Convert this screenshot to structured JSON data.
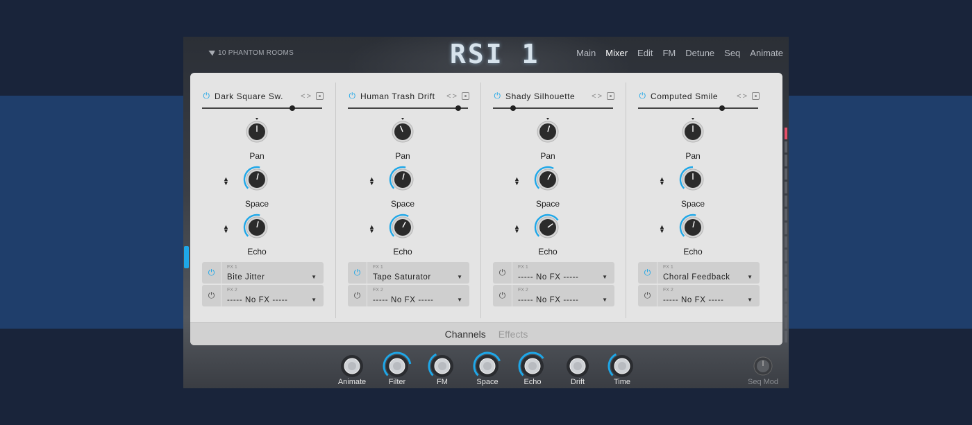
{
  "header": {
    "brand": "10 PHANTOM ROOMS",
    "logo": "RSI 1",
    "nav": [
      "Main",
      "Mixer",
      "Edit",
      "FM",
      "Detune",
      "Seq",
      "Animate"
    ],
    "active_nav": "Mixer"
  },
  "channels": [
    {
      "name": "Dark Square Sw.",
      "power": true,
      "level": 0.75,
      "pan": 0.5,
      "space": 0.55,
      "echo": 0.55,
      "fx1_label": "FX 1",
      "fx1": "Bite Jitter",
      "fx1_on": true,
      "fx2_label": "FX 2",
      "fx2": "----- No FX -----",
      "fx2_on": false
    },
    {
      "name": "Human Trash Drift",
      "power": true,
      "level": 0.92,
      "pan": 0.42,
      "space": 0.55,
      "echo": 0.6,
      "fx1_label": "FX 1",
      "fx1": "Tape Saturator",
      "fx1_on": true,
      "fx2_label": "FX 2",
      "fx2": "----- No FX -----",
      "fx2_on": false
    },
    {
      "name": "Shady Silhouette",
      "power": true,
      "level": 0.17,
      "pan": 0.56,
      "space": 0.6,
      "echo": 0.7,
      "fx1_label": "FX 1",
      "fx1": "----- No FX -----",
      "fx1_on": false,
      "fx2_label": "FX 2",
      "fx2": "----- No FX -----",
      "fx2_on": false
    },
    {
      "name": "Computed Smile",
      "power": true,
      "level": 0.7,
      "pan": 0.5,
      "space": 0.5,
      "echo": 0.55,
      "fx1_label": "FX 1",
      "fx1": "Choral Feedback",
      "fx1_on": true,
      "fx2_label": "FX 2",
      "fx2": "----- No FX -----",
      "fx2_on": false
    }
  ],
  "knob_labels": {
    "pan": "Pan",
    "space": "Space",
    "echo": "Echo"
  },
  "tabs": {
    "channels": "Channels",
    "effects": "Effects",
    "active": "Channels"
  },
  "macros": [
    {
      "label": "Animate",
      "value": 0.0
    },
    {
      "label": "Filter",
      "value": 0.8
    },
    {
      "label": "FM",
      "value": 0.4
    },
    {
      "label": "Space",
      "value": 0.75
    },
    {
      "label": "Echo",
      "value": 0.7
    },
    {
      "label": "Drift",
      "value": 0.0
    },
    {
      "label": "Time",
      "value": 0.4
    }
  ],
  "seq_mod": {
    "label": "Seq Mod"
  },
  "colors": {
    "accent": "#1ea7e8",
    "panel": "#e4e4e4",
    "background": "#19243a",
    "band": "#1f3e6b",
    "meter_hot": "#e4506a"
  }
}
